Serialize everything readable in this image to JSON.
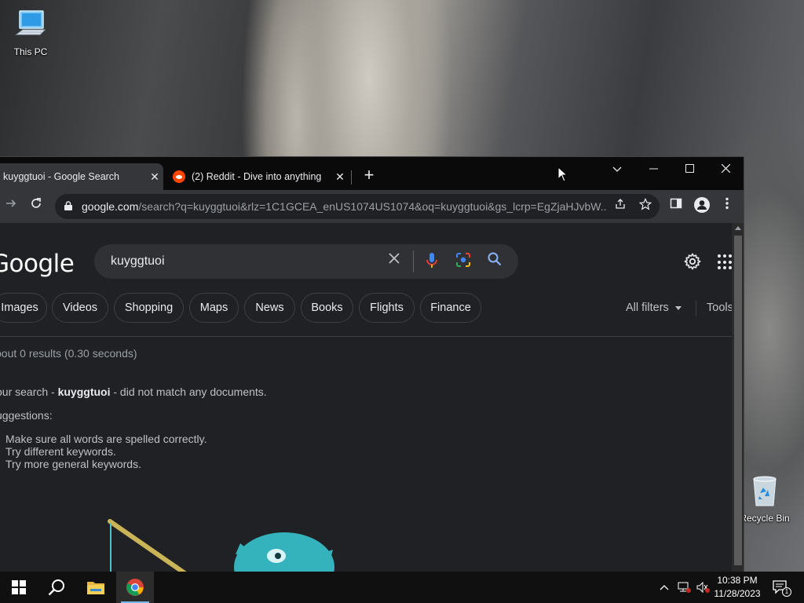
{
  "desktop": {
    "icons": [
      {
        "label": "This PC"
      },
      {
        "label": "Recycle Bin"
      }
    ]
  },
  "browser": {
    "tabs": [
      {
        "title": "kuyggtuoi - Google Search",
        "active": true
      },
      {
        "title": "(2) Reddit - Dive into anything",
        "active": false
      }
    ],
    "new_tab_glyph": "+",
    "window_controls": {
      "tab_search": "⌄",
      "minimize": "—",
      "maximize": "☐",
      "close": "✕"
    },
    "address": {
      "host": "google.com",
      "path": "/search?q=kuyggtuoi&rlz=1C1GCEA_enUS1074US1074&oq=kuyggtuoi&gs_lcrp=EgZjaHJvbW..."
    }
  },
  "google": {
    "logo": "Google",
    "query": "kuyggtuoi",
    "filters": [
      "Images",
      "Videos",
      "Shopping",
      "Maps",
      "News",
      "Books",
      "Flights",
      "Finance"
    ],
    "all_filters": "All filters",
    "tools": "Tools",
    "stats": "bout 0 results (0.30 seconds)",
    "no_results": {
      "prefix": "our search - ",
      "term": "kuyggtuoi",
      "suffix": " - did not match any documents."
    },
    "suggestions_heading": "uggestions:",
    "suggestions": [
      "Make sure all words are spelled correctly.",
      "Try different keywords.",
      "Try more general keywords."
    ]
  },
  "taskbar": {
    "clock_time": "10:38 PM",
    "clock_date": "11/28/2023",
    "notification_count": "1"
  },
  "colors": {
    "page_bg": "#202124",
    "chip_border": "#3c4043",
    "mic_blue": "#4285f4",
    "search_blue": "#8ab4f8",
    "reddit_orange": "#ff4500",
    "accent": "#76b9ed"
  }
}
